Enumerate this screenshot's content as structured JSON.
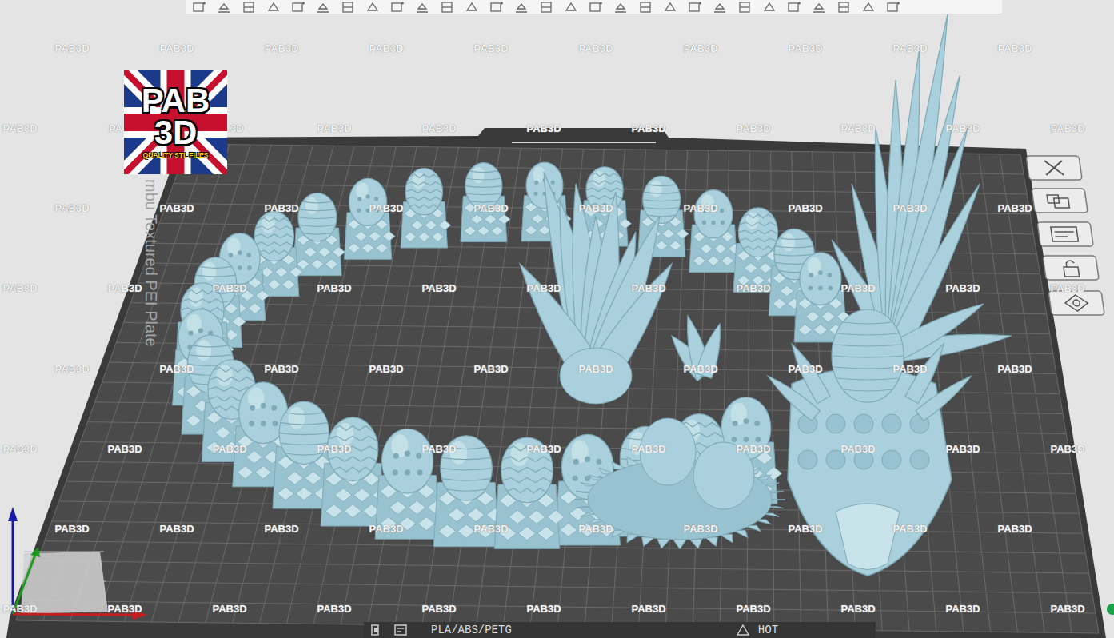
{
  "logo": {
    "line1": "PAB",
    "line2": "3D",
    "tagline": "QUALITY STL FILES"
  },
  "plate": {
    "label": "mbu Textured PEI Plate",
    "filament": "PLA/ABS/PETG",
    "mode": "HOT"
  },
  "watermark": {
    "rows": [
      [
        "PAB3D",
        "PAB3D",
        "PAB3D",
        "PAB3D",
        "PAB3D",
        "PAB3D",
        "PAB3D",
        "PAB3D",
        "PAB3D",
        "PAB3D"
      ],
      [
        "PAB3D",
        "PA",
        "3D",
        "PAB3D",
        "PAB3D",
        "PAB3D",
        "PAB3D",
        "PAB3D",
        "PAB3D",
        "PAB3D",
        "PAB3D"
      ],
      [
        "PAB3D",
        "PAB3D",
        "PAB3D",
        "PAB3D",
        "PAB3D",
        "PAB3D",
        "PAB3D",
        "PAB3D",
        "PAB3D",
        "PAB3D"
      ],
      [
        "PAB3D",
        "PAB3D",
        "PAB3D",
        "PAB3D",
        "PAB3D",
        "PAB3D",
        "PAB3D",
        "PAB3D",
        "PAB3D",
        "PAB3D",
        "PAB3D"
      ],
      [
        "PAB3D",
        "PAB3D",
        "PAB3D",
        "PAB3D",
        "PAB3D",
        "PAB3D",
        "PAB3D",
        "PAB3D",
        "PAB3D",
        "PAB3D"
      ],
      [
        "PAB3D",
        "PAB3D",
        "PAB3D",
        "PAB3D",
        "PAB3D",
        "PAB3D",
        "PAB3D",
        "PAB3D",
        "PAB3D",
        "PAB3D",
        "PAB3D"
      ],
      [
        "PAB3D",
        "PAB3D",
        "PAB3D",
        "PAB3D",
        "PAB3D",
        "PAB3D",
        "PAB3D",
        "PAB3D",
        "PAB3D",
        "PAB3D"
      ],
      [
        "PAB3D",
        "PAB3D",
        "PAB3D",
        "PAB3D",
        "PAB3D",
        "PAB3D",
        "PAB3D",
        "PAB3D",
        "PAB3D",
        "PAB3D",
        "PAB3D"
      ]
    ]
  }
}
